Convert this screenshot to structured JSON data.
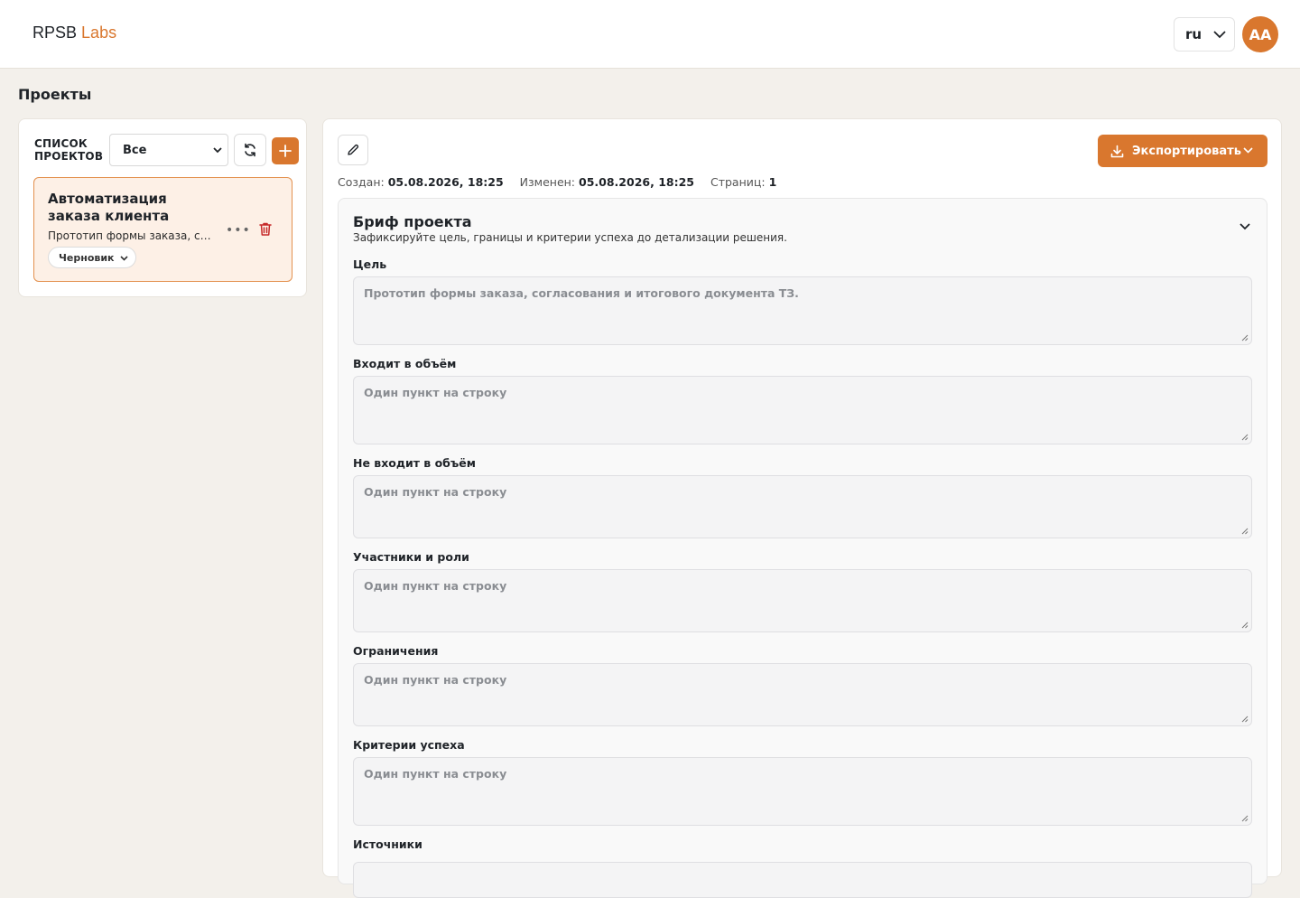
{
  "header": {
    "brand_part1": "RPSB",
    "brand_part2": "Labs",
    "language": "ru",
    "avatar_initials": "AA"
  },
  "page": {
    "title": "Проекты"
  },
  "sidebar": {
    "label_line1": "СПИСОК",
    "label_line2": "ПРОЕКТОВ",
    "filter_value": "Все",
    "projects": [
      {
        "title": "Автоматизация заказа клиента",
        "description": "Прототип формы заказа, согласования и итогового документа ТЗ.",
        "status": "Черновик"
      }
    ]
  },
  "main": {
    "export_label": "Экспортировать",
    "meta": {
      "created_label": "Создан:",
      "created_value": "05.08.2026, 18:25",
      "modified_label": "Изменен:",
      "modified_value": "05.08.2026, 18:25",
      "pages_label": "Страниц:",
      "pages_value": "1"
    },
    "brief": {
      "title": "Бриф проекта",
      "subtitle": "Зафиксируйте цель, границы и критерии успеха до детализации решения.",
      "fields": [
        {
          "label": "Цель",
          "placeholder": "Прототип формы заказа, согласования и итогового документа ТЗ."
        },
        {
          "label": "Входит в объём",
          "placeholder": "Один пункт на строку"
        },
        {
          "label": "Не входит в объём",
          "placeholder": "Один пункт на строку"
        },
        {
          "label": "Участники и роли",
          "placeholder": "Один пункт на строку"
        },
        {
          "label": "Ограничения",
          "placeholder": "Один пункт на строку"
        },
        {
          "label": "Критерии успеха",
          "placeholder": "Один пункт на строку"
        },
        {
          "label": "Источники",
          "placeholder": ""
        }
      ]
    }
  },
  "colors": {
    "accent": "#d9772e",
    "card_bg": "#fdf0e6",
    "delete": "#c62828"
  }
}
